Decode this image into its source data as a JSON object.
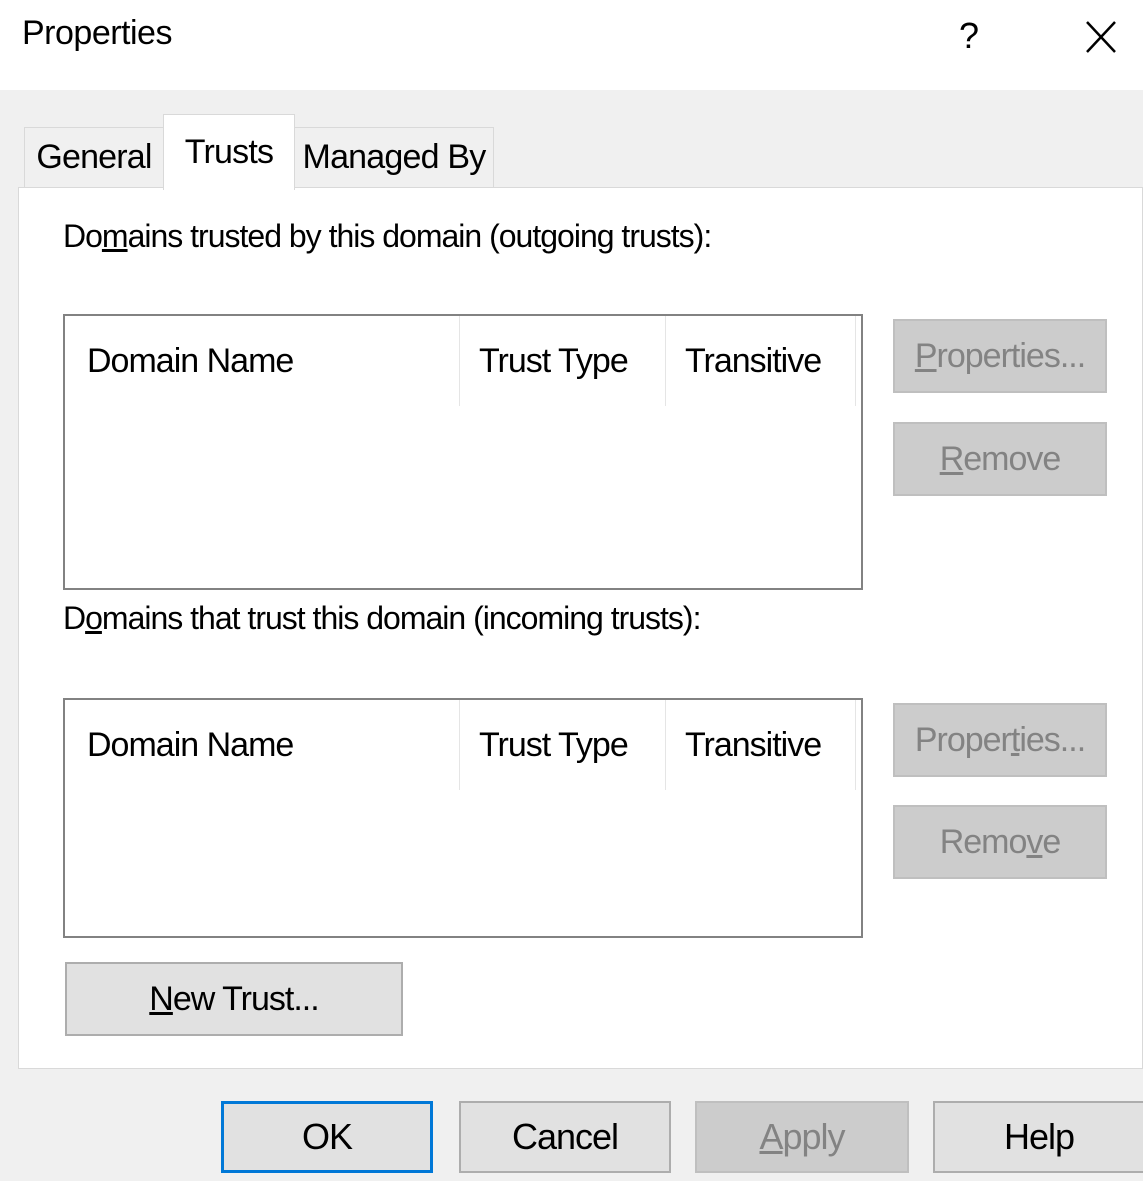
{
  "window": {
    "title": "Properties",
    "help_glyph": "?",
    "close_icon": "close-icon"
  },
  "tabs": [
    {
      "label": "General",
      "active": false
    },
    {
      "label": "Trusts",
      "active": true
    },
    {
      "label": "Managed By",
      "active": false
    }
  ],
  "outgoing": {
    "label_pre": "Do",
    "label_key": "m",
    "label_post": "ains trusted by this domain (outgoing trusts):",
    "columns": [
      "Domain Name",
      "Trust Type",
      "Transitive"
    ],
    "rows": [],
    "properties_button": {
      "key": "P",
      "rest": "roperties..."
    },
    "remove_button": {
      "key": "R",
      "rest": "emove"
    }
  },
  "incoming": {
    "label_pre": "D",
    "label_key": "o",
    "label_post": "mains that trust this domain (incoming trusts):",
    "columns": [
      "Domain Name",
      "Trust Type",
      "Transitive"
    ],
    "rows": [],
    "properties_button": {
      "pre": "Proper",
      "key": "t",
      "rest": "ies..."
    },
    "remove_button": {
      "pre": "Remo",
      "key": "v",
      "rest": "e"
    }
  },
  "new_trust_button": {
    "key": "N",
    "rest": "ew Trust..."
  },
  "footer": {
    "ok": "OK",
    "cancel": "Cancel",
    "apply_key": "A",
    "apply_rest": "pply",
    "help": "Help"
  },
  "colors": {
    "accent": "#0078d7",
    "panel": "#ffffff",
    "background": "#f0f0f0",
    "disabled_text": "#838383"
  }
}
